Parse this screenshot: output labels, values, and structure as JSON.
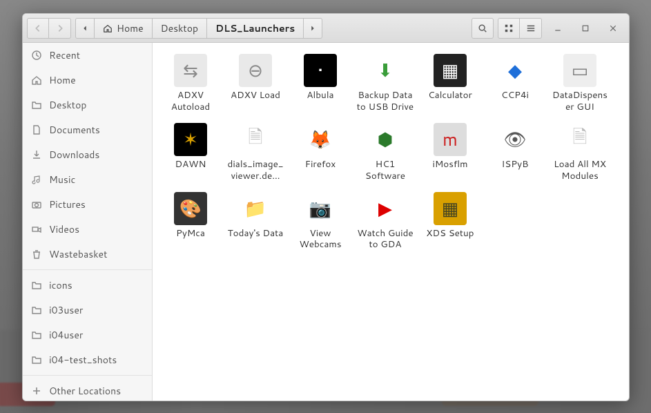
{
  "path": {
    "home": "Home",
    "crumbs": [
      "Desktop",
      "DLS_Launchers"
    ],
    "active_index": 1
  },
  "sidebar": {
    "items": [
      {
        "label": "Recent",
        "icon": "clock"
      },
      {
        "label": "Home",
        "icon": "home"
      },
      {
        "label": "Desktop",
        "icon": "folder"
      },
      {
        "label": "Documents",
        "icon": "doc"
      },
      {
        "label": "Downloads",
        "icon": "download"
      },
      {
        "label": "Music",
        "icon": "music"
      },
      {
        "label": "Pictures",
        "icon": "camera"
      },
      {
        "label": "Videos",
        "icon": "video"
      },
      {
        "label": "Wastebasket",
        "icon": "trash"
      }
    ],
    "bookmarks": [
      {
        "label": "icons"
      },
      {
        "label": "i03user"
      },
      {
        "label": "i04user"
      },
      {
        "label": "i04-test_shots"
      }
    ],
    "other": "Other Locations"
  },
  "files": [
    {
      "label": "ADXV Autoload",
      "thumb_bg": "#e9e9e9",
      "thumb_fg": "#888",
      "glyph": "⇆"
    },
    {
      "label": "ADXV Load",
      "thumb_bg": "#e9e9e9",
      "thumb_fg": "#888",
      "glyph": "⊖"
    },
    {
      "label": "Albula",
      "thumb_bg": "#000",
      "thumb_fg": "#fff",
      "glyph": "•"
    },
    {
      "label": "Backup Data to USB Drive",
      "thumb_bg": "#fff",
      "thumb_fg": "#3a9d3a",
      "glyph": "⬇"
    },
    {
      "label": "Calculator",
      "thumb_bg": "#222",
      "thumb_fg": "#fff",
      "glyph": "▦"
    },
    {
      "label": "CCP4i",
      "thumb_bg": "#fff",
      "thumb_fg": "#1e6fd9",
      "glyph": "◆"
    },
    {
      "label": "DataDispenser GUI",
      "thumb_bg": "#eee",
      "thumb_fg": "#7a7a7a",
      "glyph": "▭"
    },
    {
      "label": "DAWN",
      "thumb_bg": "#000",
      "thumb_fg": "#d9a000",
      "glyph": "✶"
    },
    {
      "label": "dials_image_viewer.de…",
      "thumb_bg": "#fff",
      "thumb_fg": "#bbb",
      "glyph": "🗎"
    },
    {
      "label": "Firefox",
      "thumb_bg": "#fff",
      "thumb_fg": "#e66000",
      "glyph": "🦊"
    },
    {
      "label": "HC1 Software",
      "thumb_bg": "#fff",
      "thumb_fg": "#2b7a2b",
      "glyph": "⬢"
    },
    {
      "label": "iMosflm",
      "thumb_bg": "#ddd",
      "thumb_fg": "#c22",
      "glyph": "m"
    },
    {
      "label": "ISPyB",
      "thumb_bg": "#fff",
      "thumb_fg": "#555",
      "glyph": "👁"
    },
    {
      "label": "Load All MX Modules",
      "thumb_bg": "#fff",
      "thumb_fg": "#bbb",
      "glyph": "🗎"
    },
    {
      "label": "PyMca",
      "thumb_bg": "#333",
      "thumb_fg": "#caa36b",
      "glyph": "🎨"
    },
    {
      "label": "Today's Data",
      "thumb_bg": "#fff",
      "thumb_fg": "#e0b000",
      "glyph": "📁"
    },
    {
      "label": "View Webcams",
      "thumb_bg": "#fff",
      "thumb_fg": "#222",
      "glyph": "📷"
    },
    {
      "label": "Watch Guide to GDA",
      "thumb_bg": "#fff",
      "thumb_fg": "#d00",
      "glyph": "▶"
    },
    {
      "label": "XDS Setup",
      "thumb_bg": "#d9a000",
      "thumb_fg": "#442",
      "glyph": "▦"
    }
  ]
}
